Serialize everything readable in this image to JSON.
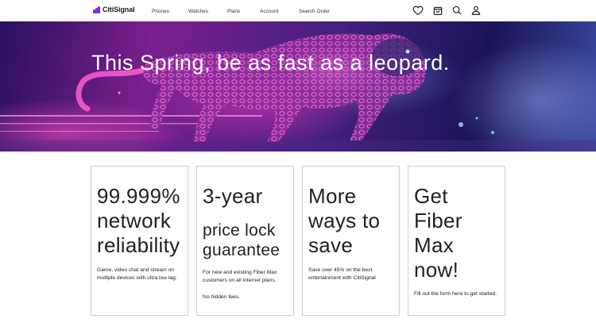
{
  "brand": {
    "name": "CitiSignal",
    "accent": "#7a2ce0"
  },
  "nav": [
    {
      "label": "Phones"
    },
    {
      "label": "Watches"
    },
    {
      "label": "Plans"
    },
    {
      "label": "Account"
    },
    {
      "label": "Search Order"
    }
  ],
  "header_icons": [
    "heart-icon",
    "shopping-bag-icon",
    "search-icon",
    "user-icon"
  ],
  "hero": {
    "title": "This Spring, be as fast as a leopard."
  },
  "cards": [
    {
      "title_lines": [
        "99.999%",
        "network",
        "reliability"
      ],
      "description": "Game, video chat and stream on multiple devices with ultra low lag."
    },
    {
      "title_line": "3-year",
      "subtitle_lines": [
        "price lock",
        "guarantee"
      ],
      "description": "For new and existing Fiber Max customers on all internet plans.",
      "note": "No hidden fees."
    },
    {
      "title_lines": [
        "More",
        "ways to",
        "save"
      ],
      "description": "Save over 45% on the best entertainment with CitiSignal"
    },
    {
      "title_lines": [
        "Get",
        "Fiber",
        "Max",
        "now!"
      ],
      "description": "Fill out the form here to get started."
    }
  ]
}
